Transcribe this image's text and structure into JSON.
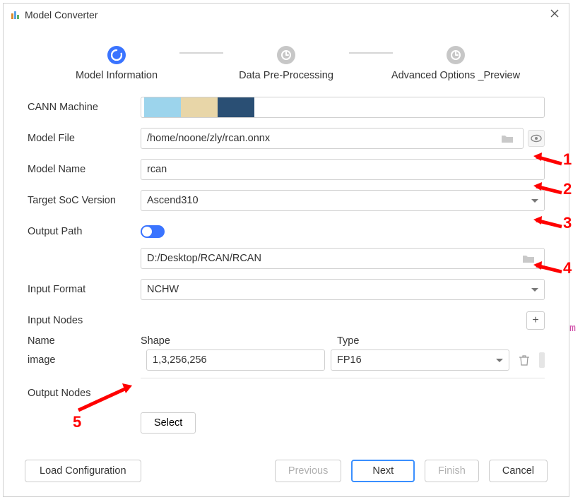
{
  "title": "Model Converter",
  "steps": {
    "s1": "Model Information",
    "s2": "Data Pre-Processing",
    "s3": "Advanced Options _Preview"
  },
  "labels": {
    "cann": "CANN Machine",
    "modelFile": "Model File",
    "modelName": "Model Name",
    "targetSoc": "Target SoC Version",
    "outputPath": "Output Path",
    "inputFormat": "Input Format",
    "inputNodes": "Input Nodes",
    "name": "Name",
    "shape": "Shape",
    "type": "Type",
    "outputNodes": "Output Nodes"
  },
  "values": {
    "modelFile": "/home/noone/zly/rcan.onnx",
    "modelName": "rcan",
    "targetSoc": "Ascend310",
    "outputPath": "D:/Desktop/RCAN/RCAN",
    "inputFormat": "NCHW",
    "nodeName": "image",
    "nodeShape": "1,3,256,256",
    "nodeType": "FP16"
  },
  "buttons": {
    "select": "Select",
    "loadCfg": "Load Configuration",
    "previous": "Previous",
    "next": "Next",
    "finish": "Finish",
    "cancel": "Cancel",
    "plus": "+"
  },
  "annotations": {
    "a1": "1",
    "a2": "2",
    "a3": "3",
    "a4": "4",
    "a5": "5"
  },
  "stray": {
    "m": "m"
  }
}
